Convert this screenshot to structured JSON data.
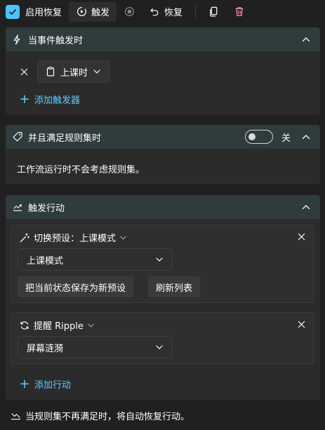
{
  "toolbar": {
    "enable_label": "启用恢复",
    "trigger_label": "触发",
    "restore_label": "恢复"
  },
  "trigger_section": {
    "title": "当事件触发时",
    "trigger_value": "上课时",
    "add_trigger_label": "添加触发器"
  },
  "ruleset_section": {
    "title": "并且满足规则集时",
    "toggle_label": "关",
    "description": "工作流运行时不会考虑规则集。"
  },
  "action_section": {
    "title": "触发行动",
    "actions": [
      {
        "title": "切换预设：上课模式",
        "select_value": "上课模式",
        "button1": "把当前状态保存为新预设",
        "button2": "刷新列表"
      },
      {
        "title": "提醒 Ripple",
        "select_value": "屏幕涟漪"
      }
    ],
    "add_action_label": "添加行动"
  },
  "footer": {
    "text": "当规则集不再满足时，将自动恢复行动。"
  },
  "colors": {
    "accent": "#60cdff",
    "checkbox": "#4cc2ff",
    "delete": "#ff99a4",
    "header": "#2f3b3c"
  }
}
